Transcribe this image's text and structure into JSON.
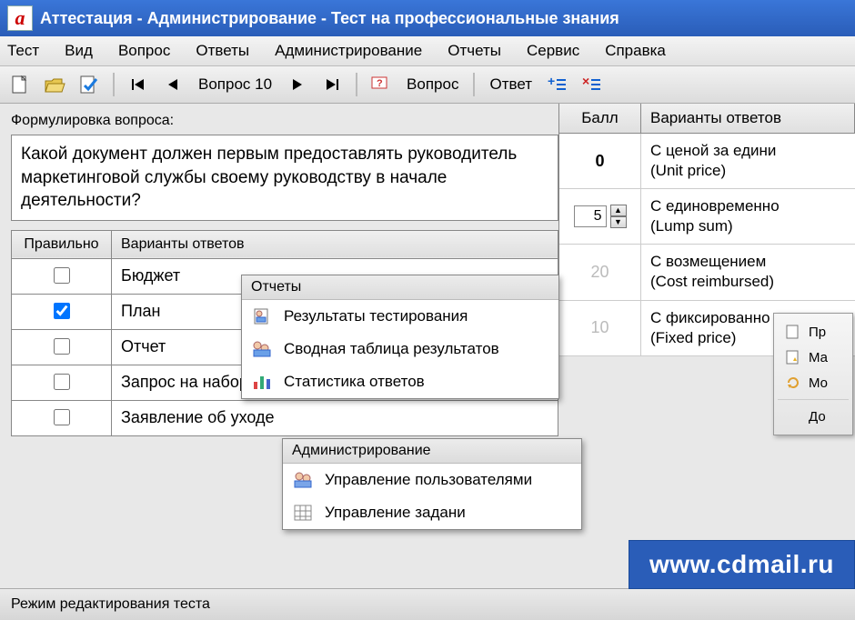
{
  "titlebar": "Аттестация - Администрирование - Тест на профессиональные знания",
  "appicon_glyph": "a",
  "menu": {
    "test": "Тест",
    "view": "Вид",
    "question": "Вопрос",
    "answers": "Ответы",
    "admin": "Администрирование",
    "reports": "Отчеты",
    "service": "Сервис",
    "help": "Справка"
  },
  "toolbar": {
    "question_counter": "Вопрос 10",
    "question_btn": "Вопрос",
    "answer_btn": "Ответ"
  },
  "question": {
    "label": "Формулировка вопроса:",
    "text": "Какой документ должен первым предоставлять руководитель маркетинговой службы своему руководству в начале деятельности?"
  },
  "answers_header": {
    "correct": "Правильно",
    "variants": "Варианты ответов"
  },
  "answers": [
    {
      "checked": false,
      "text": "Бюджет"
    },
    {
      "checked": true,
      "text": "План"
    },
    {
      "checked": false,
      "text": "Отчет"
    },
    {
      "checked": false,
      "text": "Запрос на набор сотрудников"
    },
    {
      "checked": false,
      "text": "Заявление об уходе"
    }
  ],
  "score_header": {
    "score": "Балл",
    "variants": "Варианты ответов"
  },
  "score_rows": [
    {
      "score": "0",
      "text": "С ценой за едини",
      "sub": "(Unit price)"
    },
    {
      "score_input": "5",
      "text": "С единовременно",
      "sub": "(Lump sum)"
    },
    {
      "score": "20",
      "text": "С возмещением",
      "sub": "(Cost reimbursed)"
    },
    {
      "score": "10",
      "text": "С фиксированно",
      "sub": "(Fixed price)"
    }
  ],
  "popup_reports": {
    "title": "Отчеты",
    "items": [
      "Результаты тестирования",
      "Сводная таблица результатов",
      "Статистика ответов"
    ]
  },
  "popup_admin": {
    "title": "Администрирование",
    "items": [
      "Управление пользователями",
      "Управление задани"
    ]
  },
  "side_toolbar": {
    "items": [
      "Пр",
      "Ма",
      "Мо",
      "До"
    ]
  },
  "statusbar": "Режим редактирования теста",
  "watermark": "www.cdmail.ru"
}
